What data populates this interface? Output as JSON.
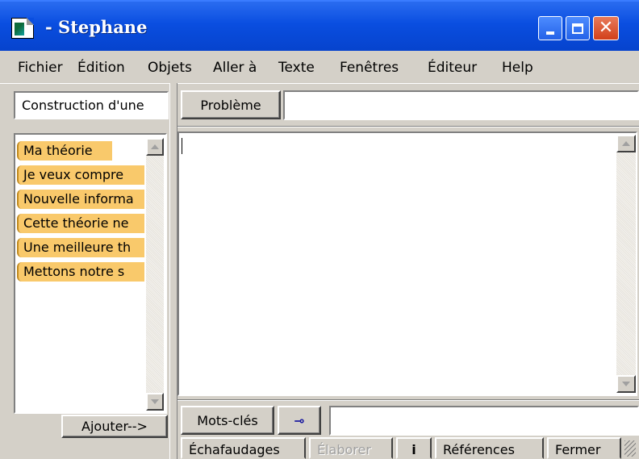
{
  "window": {
    "title": "- Stephane"
  },
  "menu": [
    "Fichier",
    "Édition",
    "Objets",
    "Aller à",
    "Texte",
    "Fenêtres",
    "Éditeur",
    "Help"
  ],
  "left_panel": {
    "title_field_value": "Construction d'une",
    "items": [
      "Ma théorie",
      "Je veux compre",
      "Nouvelle informa",
      "Cette théorie ne",
      "Une meilleure th",
      "Mettons notre s"
    ],
    "add_button_label": "Ajouter-->"
  },
  "main": {
    "problem_button_label": "Problème",
    "problem_field_value": "",
    "editor_text": "",
    "keywords_button_label": "Mots-clés",
    "key_icon_glyph": "⊸",
    "keywords_field_value": "",
    "tabs": [
      "Échafaudages",
      "Élaborer",
      "i",
      "Références",
      "Fermer"
    ]
  },
  "colors": {
    "titlebar": "#0a4ee0",
    "item_highlight": "#f9c96b",
    "chrome": "#d4d0c8"
  }
}
